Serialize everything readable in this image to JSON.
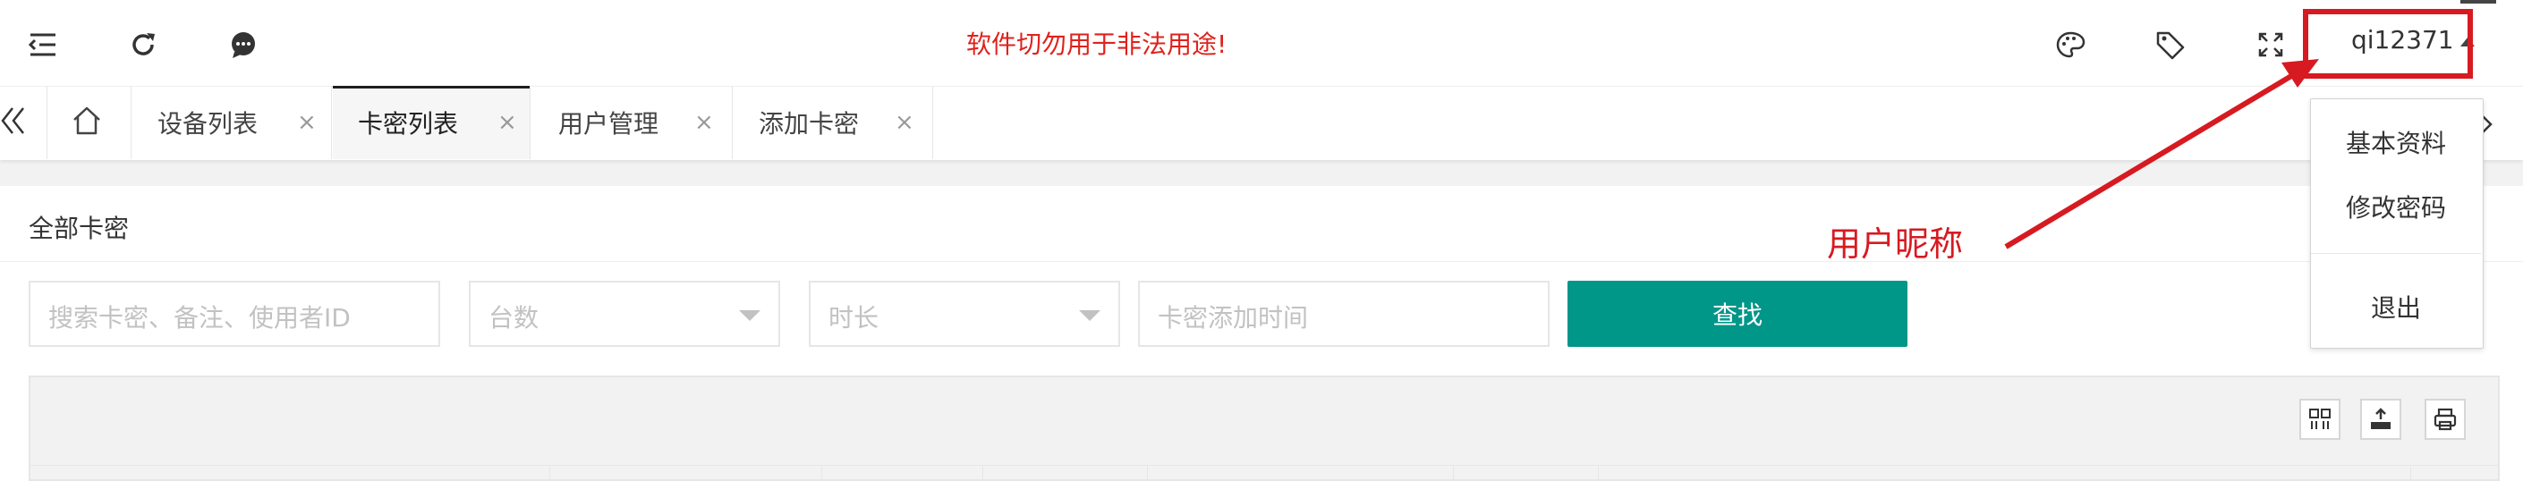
{
  "header": {
    "warning": "软件切勿用于非法用途!",
    "username": "qi12371",
    "icons": [
      "menu-fold-icon",
      "refresh-icon",
      "message-icon",
      "theme-palette-icon",
      "tag-icon",
      "fullscreen-icon"
    ]
  },
  "tabs": {
    "items": [
      {
        "label": "设备列表",
        "active": false
      },
      {
        "label": "卡密列表",
        "active": true
      },
      {
        "label": "用户管理",
        "active": false
      },
      {
        "label": "添加卡密",
        "active": false
      }
    ],
    "close_symbol": "×"
  },
  "card": {
    "title": "全部卡密",
    "search_placeholder": "搜索卡密、备注、使用者ID",
    "count_select": "台数",
    "duration_select": "时长",
    "date_placeholder": "卡密添加时间",
    "search_button": "查找"
  },
  "dropdown": {
    "items": [
      "基本资料",
      "修改密码"
    ],
    "logout": "退出"
  },
  "annotation": {
    "label": "用户昵称",
    "color": "#d71a21"
  },
  "colors": {
    "primary": "#009688",
    "warning": "#e0211c"
  }
}
